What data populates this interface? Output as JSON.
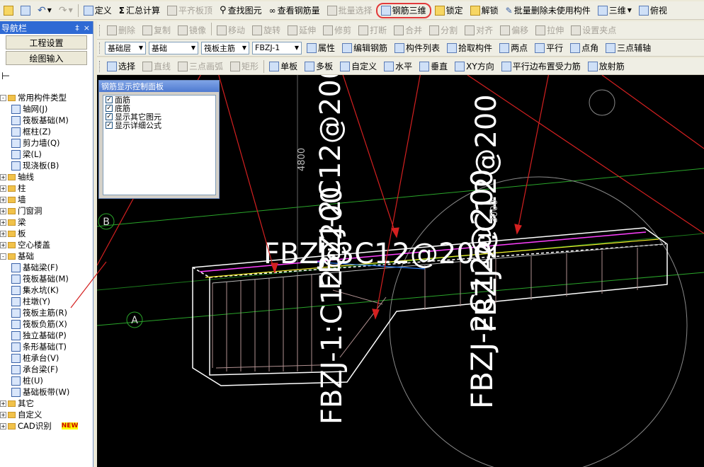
{
  "toolbar1": {
    "items": [
      {
        "label": "定义"
      },
      {
        "label": "汇总计算"
      },
      {
        "label": "平齐板顶"
      },
      {
        "label": "查找图元"
      },
      {
        "label": "查看钢筋量"
      },
      {
        "label": "批量选择"
      },
      {
        "label": "钢筋三维"
      },
      {
        "label": "锁定"
      },
      {
        "label": "解锁"
      },
      {
        "label": "批量删除未使用构件"
      },
      {
        "label": "三维"
      },
      {
        "label": "俯视"
      }
    ]
  },
  "toolbar2": {
    "items": [
      {
        "label": "删除"
      },
      {
        "label": "复制"
      },
      {
        "label": "镜像"
      },
      {
        "label": "移动"
      },
      {
        "label": "旋转"
      },
      {
        "label": "延伸"
      },
      {
        "label": "修剪"
      },
      {
        "label": "打断"
      },
      {
        "label": "合并"
      },
      {
        "label": "分割"
      },
      {
        "label": "对齐"
      },
      {
        "label": "偏移"
      },
      {
        "label": "拉伸"
      },
      {
        "label": "设置夹点"
      }
    ]
  },
  "toolbar3": {
    "layer_select": "基础层",
    "category_select": "基础",
    "type_select": "筏板主筋",
    "name_select": "FBZJ-1",
    "items": [
      {
        "label": "属性"
      },
      {
        "label": "编辑钢筋"
      },
      {
        "label": "构件列表"
      },
      {
        "label": "拾取构件"
      },
      {
        "label": "两点"
      },
      {
        "label": "平行"
      },
      {
        "label": "点角"
      },
      {
        "label": "三点辅轴"
      }
    ]
  },
  "toolbar4": {
    "items": [
      {
        "label": "选择"
      },
      {
        "label": "直线"
      },
      {
        "label": "三点画弧"
      },
      {
        "label": "矩形"
      },
      {
        "label": "单板"
      },
      {
        "label": "多板"
      },
      {
        "label": "自定义"
      },
      {
        "label": "水平"
      },
      {
        "label": "垂直"
      },
      {
        "label": "XY方向"
      },
      {
        "label": "平行边布置受力筋"
      },
      {
        "label": "放射筋"
      }
    ]
  },
  "nav": {
    "title": "导航栏",
    "pin": "‡",
    "close": "×",
    "buttons": [
      "工程设置",
      "绘图输入"
    ],
    "tree": [
      {
        "label": "常用构件类型",
        "kind": "folder",
        "indent": 0,
        "exp": "-"
      },
      {
        "label": "轴网(J)",
        "kind": "item",
        "indent": 1
      },
      {
        "label": "筏板基础(M)",
        "kind": "item",
        "indent": 1
      },
      {
        "label": "框柱(Z)",
        "kind": "item",
        "indent": 1
      },
      {
        "label": "剪力墙(Q)",
        "kind": "item",
        "indent": 1
      },
      {
        "label": "梁(L)",
        "kind": "item",
        "indent": 1
      },
      {
        "label": "现浇板(B)",
        "kind": "item",
        "indent": 1
      },
      {
        "label": "轴线",
        "kind": "folder",
        "indent": 0,
        "exp": "+"
      },
      {
        "label": "柱",
        "kind": "folder",
        "indent": 0,
        "exp": "+"
      },
      {
        "label": "墙",
        "kind": "folder",
        "indent": 0,
        "exp": "+"
      },
      {
        "label": "门窗洞",
        "kind": "folder",
        "indent": 0,
        "exp": "+"
      },
      {
        "label": "梁",
        "kind": "folder",
        "indent": 0,
        "exp": "+"
      },
      {
        "label": "板",
        "kind": "folder",
        "indent": 0,
        "exp": "+"
      },
      {
        "label": "空心楼盖",
        "kind": "folder",
        "indent": 0,
        "exp": "+"
      },
      {
        "label": "基础",
        "kind": "folder",
        "indent": 0,
        "exp": "-"
      },
      {
        "label": "基础梁(F)",
        "kind": "item",
        "indent": 1
      },
      {
        "label": "筏板基础(M)",
        "kind": "item",
        "indent": 1
      },
      {
        "label": "集水坑(K)",
        "kind": "item",
        "indent": 1
      },
      {
        "label": "柱墩(Y)",
        "kind": "item",
        "indent": 1
      },
      {
        "label": "筏板主筋(R)",
        "kind": "item",
        "indent": 1
      },
      {
        "label": "筏板负筋(X)",
        "kind": "item",
        "indent": 1
      },
      {
        "label": "独立基础(P)",
        "kind": "item",
        "indent": 1
      },
      {
        "label": "条形基础(T)",
        "kind": "item",
        "indent": 1
      },
      {
        "label": "桩承台(V)",
        "kind": "item",
        "indent": 1
      },
      {
        "label": "承台梁(F)",
        "kind": "item",
        "indent": 1
      },
      {
        "label": "桩(U)",
        "kind": "item",
        "indent": 1
      },
      {
        "label": "基础板带(W)",
        "kind": "item",
        "indent": 1
      },
      {
        "label": "其它",
        "kind": "folder",
        "indent": 0,
        "exp": "+"
      },
      {
        "label": "自定义",
        "kind": "folder",
        "indent": 0,
        "exp": "+"
      },
      {
        "label": "CAD识别",
        "kind": "folder",
        "indent": 0,
        "exp": "+"
      }
    ],
    "new_badge": "NEW"
  },
  "panel": {
    "title": "钢筋显示控制面板",
    "options": [
      "面筋",
      "底筋",
      "显示其它图元",
      "显示详细公式"
    ]
  },
  "canvas": {
    "axis_a": "A",
    "axis_b": "B",
    "dim_4800": "4800",
    "dim_3000": "3000",
    "rebar_text_1": "FBZJ-2C12@200",
    "rebar_text_2": "FBZJ-2C12@200",
    "rebar_text_3": "FBZJ-1:C12@200",
    "rebar_text_4": "FBZJ-2:C12@200",
    "rebar_text_5": "FBZJ-3C12@200"
  },
  "colors": {
    "canvas_bg": "#000000",
    "highlight": "#e23a3a",
    "axis_line": "#2aa52a",
    "rebar_top": "#ff40ff",
    "rebar_mid": "#f5f22b"
  }
}
